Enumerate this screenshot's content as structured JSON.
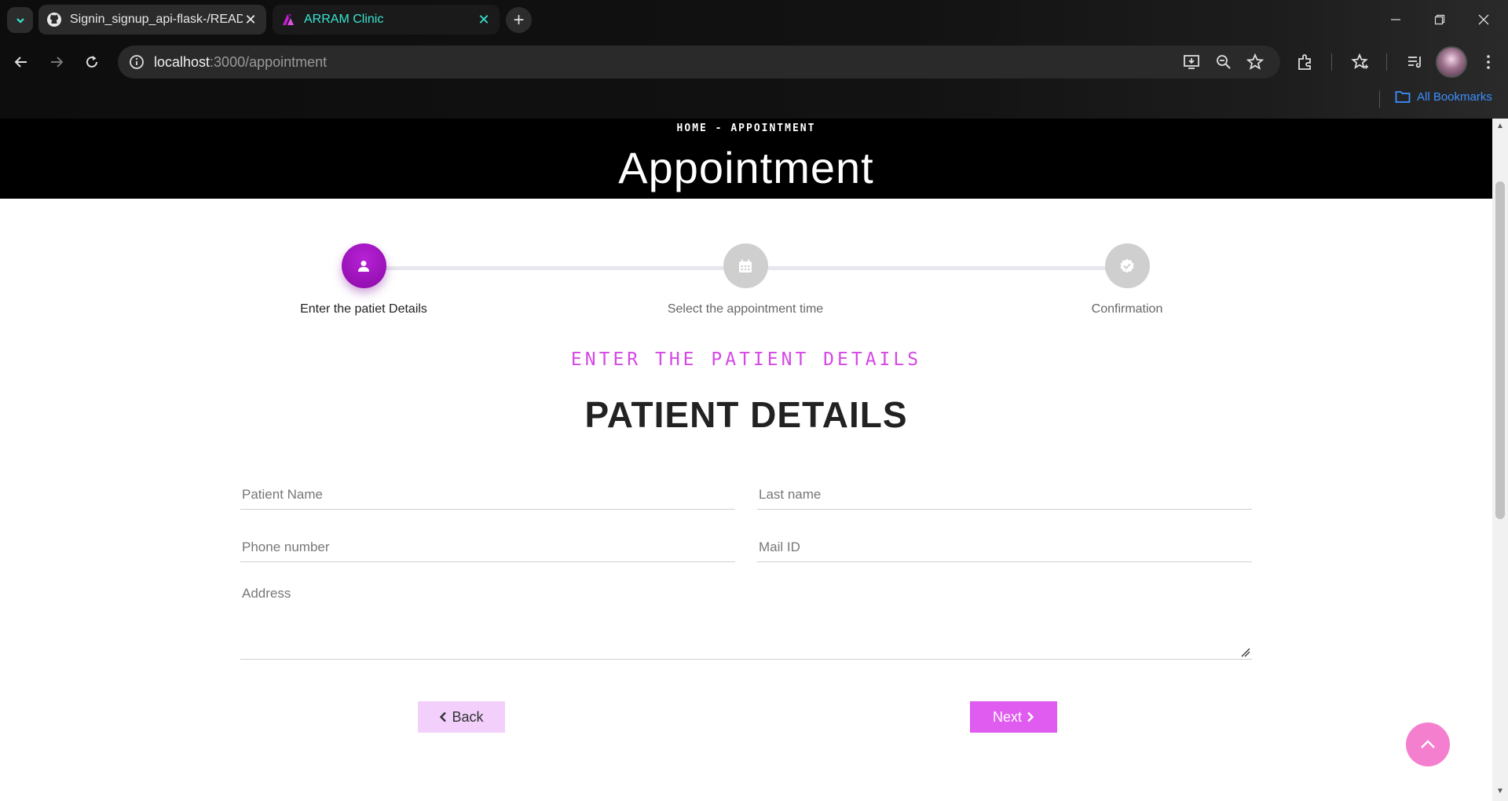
{
  "browser": {
    "tabs": [
      {
        "title": "Signin_signup_api-flask-/READM",
        "icon": "github-icon",
        "active": false
      },
      {
        "title": "ARRAM Clinic",
        "icon": "clinic-logo-icon",
        "active": true
      }
    ],
    "url_host": "localhost",
    "url_path": ":3000/appointment",
    "bookmarks_label": "All Bookmarks"
  },
  "hero": {
    "breadcrumb": "HOME - APPOINTMENT",
    "title": "Appointment"
  },
  "stepper": {
    "steps": [
      {
        "label": "Enter the patiet Details",
        "icon": "person-icon",
        "state": "active"
      },
      {
        "label": "Select the appointment time",
        "icon": "calendar-icon",
        "state": "pending"
      },
      {
        "label": "Confirmation",
        "icon": "verified-check-icon",
        "state": "pending"
      }
    ]
  },
  "form": {
    "subheading": "ENTER THE PATIENT DETAILS",
    "heading": "PATIENT DETAILS",
    "fields": {
      "patient_name": {
        "placeholder": "Patient Name",
        "value": ""
      },
      "last_name": {
        "placeholder": "Last name",
        "value": ""
      },
      "phone": {
        "placeholder": "Phone number",
        "value": ""
      },
      "mail": {
        "placeholder": "Mail ID",
        "value": ""
      },
      "address": {
        "placeholder": "Address",
        "value": ""
      }
    },
    "back_label": "Back",
    "next_label": "Next"
  },
  "colors": {
    "accent_purple": "#8a0aa6",
    "subheading_pink": "#d548e6",
    "next_button": "#e05cf0",
    "back_button": "#f2d0fb",
    "scroll_top": "#f57fcf",
    "active_tab_text": "#37e6d2"
  }
}
